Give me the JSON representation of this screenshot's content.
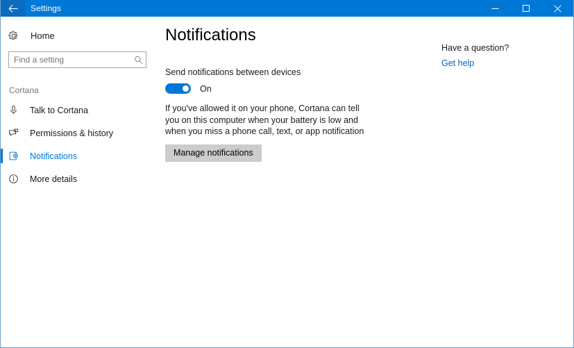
{
  "window": {
    "title": "Settings",
    "accent_color": "#0078d7",
    "back_icon": "back-arrow-icon",
    "controls": {
      "minimize": "minimize-icon",
      "maximize": "maximize-icon",
      "close": "close-icon"
    }
  },
  "sidebar": {
    "home": {
      "label": "Home",
      "icon": "gear-icon"
    },
    "search": {
      "placeholder": "Find a setting",
      "value": "",
      "icon": "search-icon"
    },
    "section_header": "Cortana",
    "items": [
      {
        "label": "Talk to Cortana",
        "icon": "microphone-icon",
        "selected": false
      },
      {
        "label": "Permissions & history",
        "icon": "speech-bubble-icon",
        "selected": false
      },
      {
        "label": "Notifications",
        "icon": "notification-page-icon",
        "selected": true
      },
      {
        "label": "More details",
        "icon": "info-circle-icon",
        "selected": false
      }
    ]
  },
  "main": {
    "title": "Notifications",
    "setting_label": "Send notifications between devices",
    "toggle": {
      "state": "On",
      "checked": true,
      "color": "#0078d7"
    },
    "description": "If you've allowed it on your phone, Cortana can tell you on this computer when your battery is low and when you miss a phone call, text, or app notification",
    "manage_button": "Manage notifications"
  },
  "help": {
    "title": "Have a question?",
    "link": "Get help",
    "link_color": "#0067c0"
  }
}
